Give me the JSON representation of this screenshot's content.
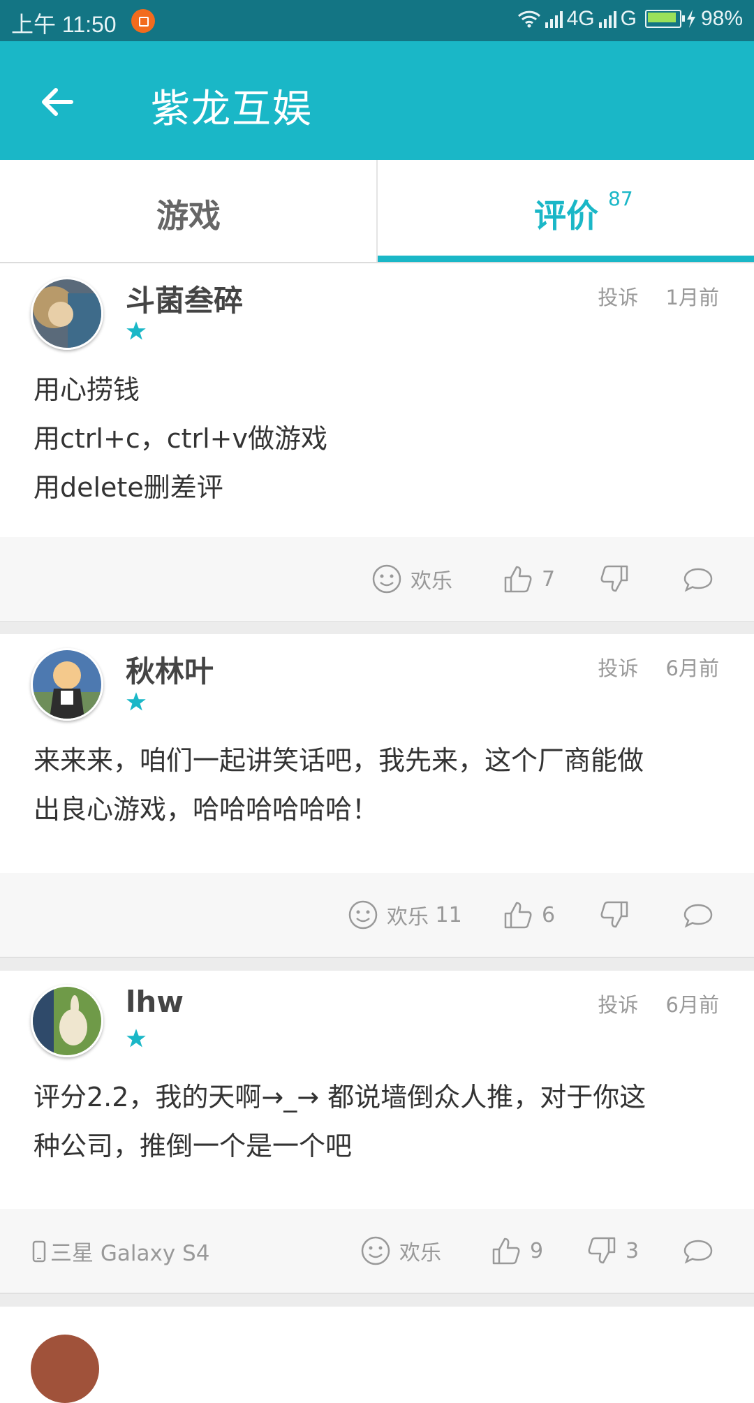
{
  "status_bar": {
    "time": "上午 11:50",
    "network": "4G",
    "network2": "G",
    "battery": "98%"
  },
  "header": {
    "title": "紫龙互娱"
  },
  "tabs": [
    {
      "label": "游戏"
    },
    {
      "label": "评价",
      "count": "87"
    }
  ],
  "reviews": [
    {
      "username": "斗菌叁碎",
      "report": "投诉",
      "time": "1月前",
      "lines": [
        "用心捞钱",
        "用ctrl+c，ctrl+v做游戏",
        "用delete删差评"
      ],
      "funny_label": "欢乐",
      "funny_count": "",
      "likes": "7",
      "dislikes": ""
    },
    {
      "username": "秋林叶",
      "report": "投诉",
      "time": "6月前",
      "lines": [
        "来来来，咱们一起讲笑话吧，我先来，这个厂商能做",
        "出良心游戏，哈哈哈哈哈哈！"
      ],
      "funny_label": "欢乐",
      "funny_count": "11",
      "likes": "6",
      "dislikes": ""
    },
    {
      "username": "lhw",
      "report": "投诉",
      "time": "6月前",
      "lines": [
        "评分2.2，我的天啊→_→ 都说墙倒众人推，对于你这",
        "种公司，推倒一个是一个吧"
      ],
      "device": "三星 Galaxy S4",
      "funny_label": "欢乐",
      "funny_count": "",
      "likes": "9",
      "dislikes": "3"
    }
  ],
  "colors": {
    "accent": "#1ab7c7",
    "status_bar": "#137584"
  },
  "icons": [
    "back-arrow-icon",
    "star-icon",
    "smile-icon",
    "thumbs-up-icon",
    "thumbs-down-icon",
    "comment-icon",
    "phone-icon"
  ]
}
